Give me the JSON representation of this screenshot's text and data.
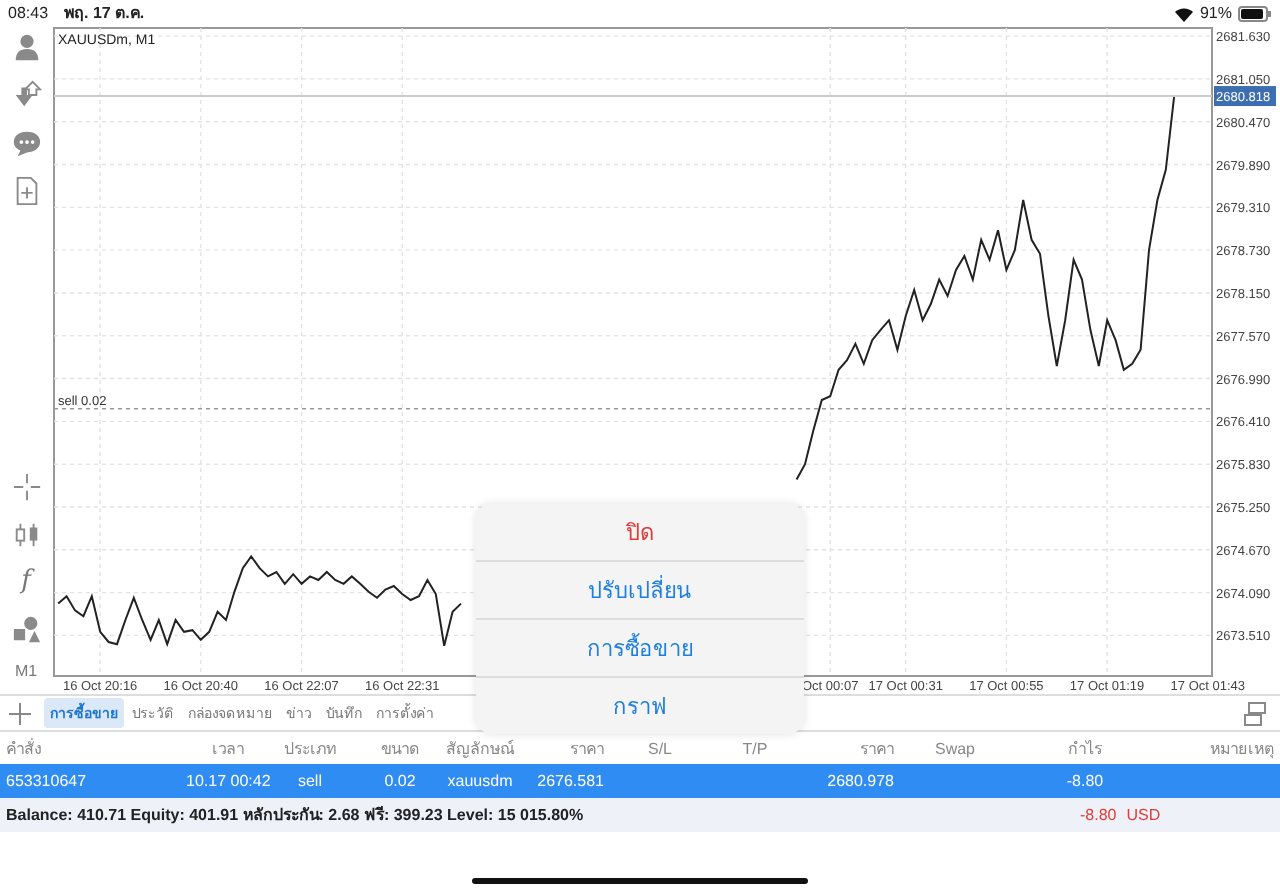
{
  "status_bar": {
    "time": "08:43",
    "date": "พฤ. 17 ต.ค.",
    "battery": "91%"
  },
  "toolbar": {
    "function_key": "f",
    "timeframe": "M1"
  },
  "chart": {
    "symbol_label": "XAUUSDm, M1",
    "chart_data": {
      "type": "line",
      "grid": true,
      "ylim": [
        2672.96,
        2681.74
      ],
      "categories": [
        null,
        null,
        null,
        null,
        null,
        "16 Oct 20:16",
        null,
        null,
        null,
        null,
        null,
        null,
        null,
        null,
        null,
        null,
        null,
        "16 Oct 20:40",
        null,
        null,
        null,
        null,
        null,
        null,
        null,
        null,
        null,
        null,
        null,
        "16 Oct 22:07",
        null,
        null,
        null,
        null,
        null,
        null,
        null,
        null,
        null,
        null,
        null,
        "16 Oct 22:31",
        null,
        null,
        null,
        null,
        null,
        null,
        null,
        null,
        null,
        null,
        null,
        null,
        null,
        null,
        null,
        null,
        null,
        null,
        null,
        null,
        null,
        null,
        null,
        null,
        null,
        null,
        null,
        null,
        null,
        null,
        null,
        null,
        null,
        null,
        null,
        null,
        null,
        null,
        null,
        null,
        null,
        null,
        null,
        null,
        null,
        null,
        null,
        null,
        null,
        null,
        "Oct 00:07",
        null,
        null,
        null,
        null,
        null,
        null,
        null,
        null,
        "17 Oct 00:31",
        null,
        null,
        null,
        null,
        null,
        null,
        null,
        null,
        null,
        null,
        null,
        "17 Oct 00:55",
        null,
        null,
        null,
        null,
        null,
        null,
        null,
        null,
        null,
        null,
        null,
        "17 Oct 01:19",
        null,
        null,
        null,
        null,
        null,
        null,
        null,
        null,
        null,
        null,
        null,
        "17 Oct 01:43"
      ],
      "series": [
        {
          "color": "#222222",
          "values": [
            2673.94,
            2674.04,
            2673.85,
            2673.77,
            2674.04,
            2673.56,
            2673.42,
            2673.39,
            2673.72,
            2674.02,
            2673.72,
            2673.45,
            2673.72,
            2673.39,
            2673.72,
            2673.56,
            2673.58,
            2673.45,
            2673.56,
            2673.83,
            2673.72,
            2674.1,
            2674.42,
            2674.58,
            2674.42,
            2674.31,
            2674.37,
            2674.21,
            2674.34,
            2674.21,
            2674.31,
            2674.26,
            2674.37,
            2674.26,
            2674.21,
            2674.31,
            2674.21,
            2674.1,
            2674.02,
            2674.13,
            2674.18,
            2674.07,
            2673.99,
            2674.04,
            2674.26,
            2674.07,
            2673.37,
            2673.83,
            2673.94,
            null,
            null,
            null,
            null,
            null,
            null,
            null,
            null,
            null,
            null,
            null,
            null,
            null,
            null,
            null,
            null,
            null,
            null,
            null,
            null,
            null,
            null,
            null,
            null,
            null,
            null,
            null,
            null,
            null,
            null,
            null,
            null,
            null,
            null,
            null,
            null,
            null,
            null,
            null,
            2675.62,
            2675.83,
            2676.29,
            2676.7,
            2676.75,
            2677.11,
            2677.24,
            2677.46,
            2677.19,
            2677.51,
            2677.65,
            2677.78,
            2677.38,
            2677.84,
            2678.19,
            2677.78,
            2678.0,
            2678.33,
            2678.11,
            2678.46,
            2678.65,
            2678.33,
            2678.87,
            2678.6,
            2679.0,
            2678.46,
            2678.73,
            2679.41,
            2678.87,
            2678.68,
            2677.84,
            2677.16,
            2677.78,
            2678.6,
            2678.33,
            2677.65,
            2677.16,
            2677.78,
            2677.51,
            2677.11,
            2677.19,
            2677.38,
            2678.73,
            2679.41,
            2679.82,
            2680.82,
            null,
            null,
            null,
            null
          ]
        }
      ],
      "yticks": [
        {
          "value": 2673.51,
          "label": "2673.510"
        },
        {
          "value": 2674.09,
          "label": "2674.090"
        },
        {
          "value": 2674.67,
          "label": "2674.670"
        },
        {
          "value": 2675.25,
          "label": "2675.250"
        },
        {
          "value": 2675.83,
          "label": "2675.830"
        },
        {
          "value": 2676.41,
          "label": "2676.410"
        },
        {
          "value": 2676.99,
          "label": "2676.990"
        },
        {
          "value": 2677.57,
          "label": "2677.570"
        },
        {
          "value": 2678.15,
          "label": "2678.150"
        },
        {
          "value": 2678.73,
          "label": "2678.730"
        },
        {
          "value": 2679.31,
          "label": "2679.310"
        },
        {
          "value": 2679.89,
          "label": "2679.890"
        },
        {
          "value": 2680.47,
          "label": "2680.470"
        },
        {
          "value": 2681.05,
          "label": "2681.050"
        },
        {
          "value": 2681.63,
          "label": "2681.630"
        }
      ]
    },
    "current_price": "2680.818",
    "order_label": "sell 0.02"
  },
  "tabs": [
    {
      "label": "การซื้อขาย",
      "selected": true
    },
    {
      "label": "ประวัติ",
      "selected": false
    },
    {
      "label": "กล่องจดหมาย",
      "selected": false
    },
    {
      "label": "ข่าว",
      "selected": false
    },
    {
      "label": "บันทึก",
      "selected": false
    },
    {
      "label": "การตั้งค่า",
      "selected": false
    }
  ],
  "positions": {
    "columns": [
      "คำสั่ง",
      "เวลา",
      "ประเภท",
      "ขนาด",
      "สัญลักษณ์",
      "ราคา",
      "S/L",
      "T/P",
      "ราคา",
      "Swap",
      "กำไร",
      "หมายเหตุ"
    ],
    "rows": [
      {
        "selected": true,
        "order": "653310647",
        "time": "10.17 00:42",
        "type": "sell",
        "volume": "0.02",
        "symbol": "xauusdm",
        "open_price": "2676.581",
        "current_price": "2680.978",
        "profit": "-8.80"
      }
    ]
  },
  "account": {
    "summary": "Balance: 410.71 Equity: 401.91 หลักประกัน: 2.68 ฟรี: 399.23 Level: 15 015.80%",
    "profit": "-8.80",
    "currency": "USD"
  },
  "context_menu": {
    "items": [
      {
        "label": "ปิด",
        "kind": "destructive"
      },
      {
        "label": "ปรับเปลี่ยน",
        "kind": "default"
      },
      {
        "label": "การซื้อขาย",
        "kind": "default"
      },
      {
        "label": "กราฟ",
        "kind": "default"
      }
    ]
  }
}
